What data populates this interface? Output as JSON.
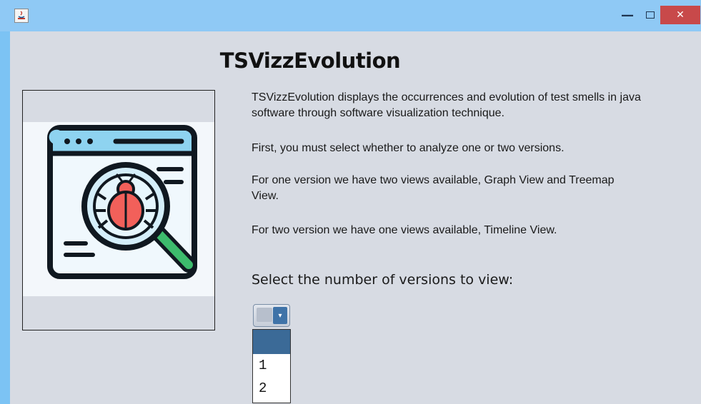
{
  "window": {
    "title": "",
    "controls": {
      "minimize": "—",
      "maximize": "□",
      "close": "✕"
    }
  },
  "app": {
    "title": "TSVizzEvolution",
    "paragraphs": [
      "TSVizzEvolution displays the occurrences and evolution of test smells in java software through software visualization technique.",
      "First, you must select whether to analyze one or two versions.",
      "For one version we have two views available, Graph View and Treemap View.",
      "For two version we have one views available, Timeline View."
    ],
    "prompt": "Select the number of versions to view:"
  },
  "combo": {
    "selected": "",
    "options": [
      "",
      "1",
      "2"
    ],
    "arrow": "▾"
  },
  "colors": {
    "titlebar": "#8fc9f5",
    "panel": "#d7dbe3",
    "close": "#c8494a",
    "accent": "#3b6a97",
    "bug": "#f2605a",
    "handle": "#3dbb6c"
  }
}
